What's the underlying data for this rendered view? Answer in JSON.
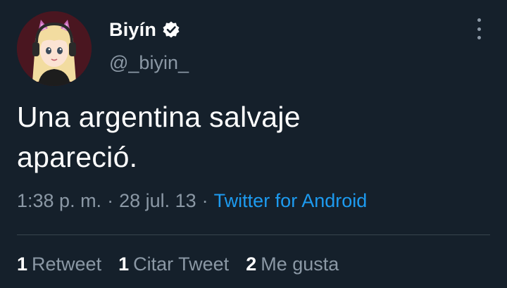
{
  "author": {
    "display_name": "Biyín",
    "handle": "@_biyin_",
    "avatar_icon": "cartoon-girl-with-cat-ear-headphones",
    "verified_icon": "verified-badge-icon"
  },
  "tweet": {
    "text_line1": "Una argentina salvaje",
    "text_line2": "apareció."
  },
  "meta": {
    "time": "1:38 p. m.",
    "separator": "·",
    "date": "28 jul. 13",
    "source": "Twitter for Android"
  },
  "stats": {
    "retweets_count": "1",
    "retweets_label": "Retweet",
    "quotes_count": "1",
    "quotes_label": "Citar Tweet",
    "likes_count": "2",
    "likes_label": "Me gusta"
  },
  "colors": {
    "background": "#15202b",
    "text_primary": "#ffffff",
    "text_secondary": "#8b98a5",
    "link": "#1d9bf0",
    "divider": "#38444d"
  }
}
